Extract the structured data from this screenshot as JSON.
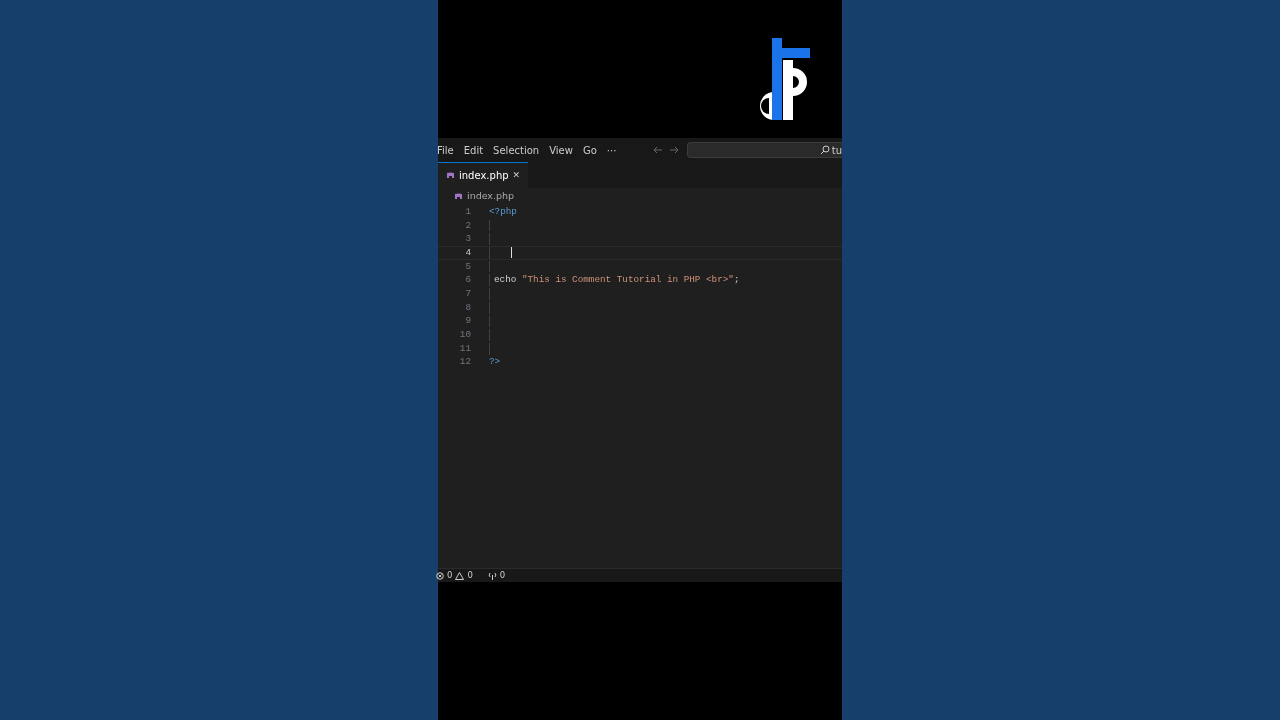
{
  "menu_bar": {
    "items": [
      "File",
      "Edit",
      "Selection",
      "View",
      "Go",
      "···"
    ],
    "search": {
      "value": "tu"
    }
  },
  "tabs": [
    {
      "label": "index.php",
      "selected": true,
      "close": "✕"
    }
  ],
  "breadcrumb": "index.php",
  "editor": {
    "lines": [
      {
        "number": "1",
        "active": false,
        "guide": false,
        "tokens": [
          {
            "kind": "keyword",
            "text": "<?php"
          }
        ]
      },
      {
        "number": "2",
        "active": false,
        "guide": true
      },
      {
        "number": "3",
        "active": false,
        "guide": true
      },
      {
        "number": "4",
        "active": true,
        "guide": true
      },
      {
        "number": "5",
        "active": false,
        "guide": true
      },
      {
        "number": "6",
        "active": false,
        "guide": true,
        "tokens": [
          {
            "kind": "plain",
            "text": "echo "
          },
          {
            "kind": "string",
            "text": "\"This is Comment Tutorial in PHP <br>\""
          },
          {
            "kind": "plain",
            "text": ";"
          }
        ]
      },
      {
        "number": "7",
        "active": false,
        "guide": true
      },
      {
        "number": "8",
        "active": false,
        "guide": true
      },
      {
        "number": "9",
        "active": false,
        "guide": true
      },
      {
        "number": "10",
        "active": false,
        "guide": true
      },
      {
        "number": "11",
        "active": false,
        "guide": true
      },
      {
        "number": "12",
        "active": false,
        "guide": false,
        "tokens": [
          {
            "kind": "keyword",
            "text": "?>"
          }
        ]
      }
    ]
  },
  "status_bar": {
    "errors": "0",
    "warnings": "0",
    "ports": "0"
  }
}
